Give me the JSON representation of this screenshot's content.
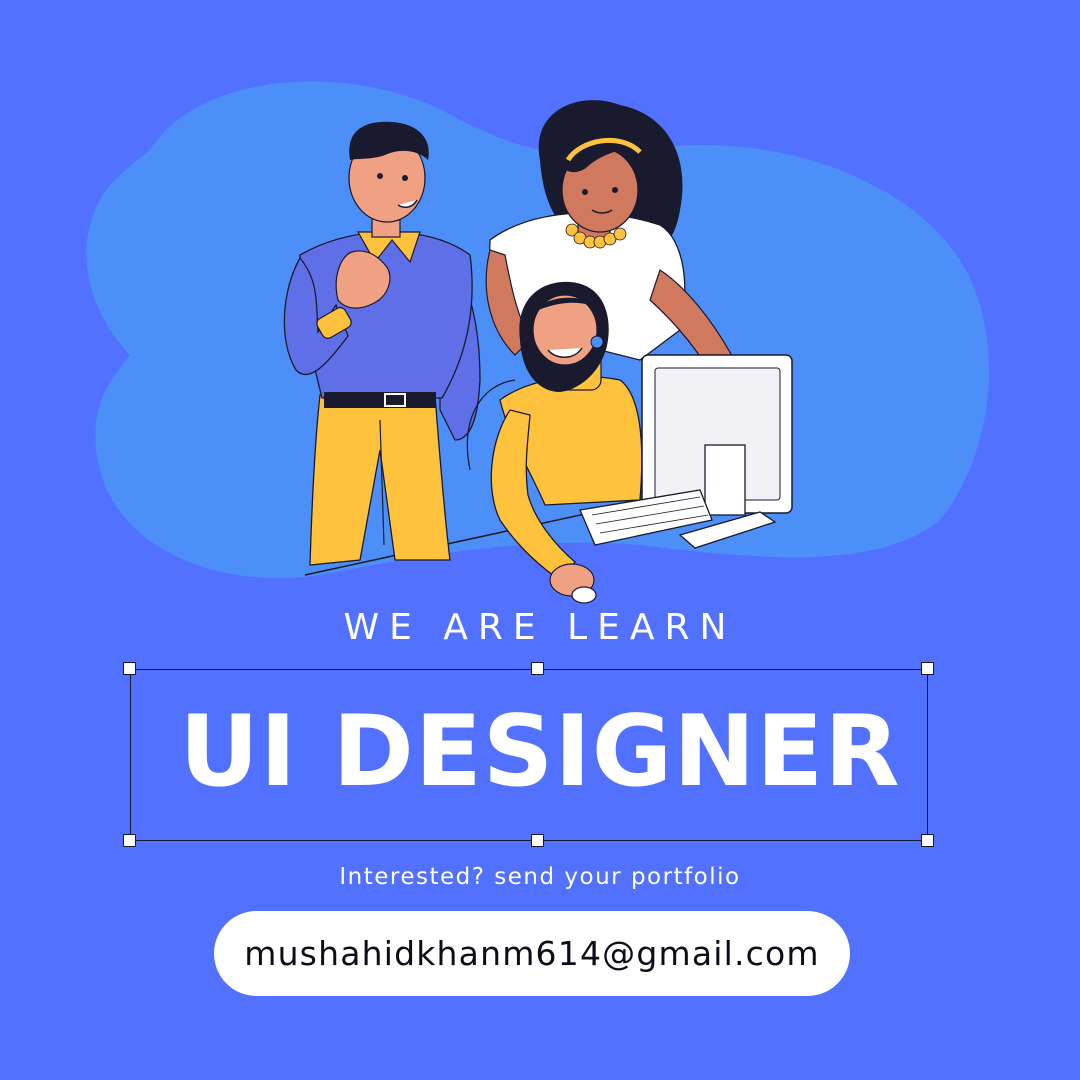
{
  "poster": {
    "tagline": "WE ARE LEARN",
    "headline": "UI DESIGNER",
    "subline": "Interested? send your portfolio",
    "email": "mushahidkhanm614@gmail.com"
  },
  "colors": {
    "background": "#5271ff",
    "blob": "#4d8ff8",
    "text": "#ffffff",
    "pill": "#ffffff",
    "pill_text": "#0d0d1a",
    "accent_yellow": "#ffc23d"
  },
  "illustration": {
    "subject": "three-people-at-computer",
    "icons": [
      "man-figure",
      "curly-hair-woman-figure",
      "seated-woman-figure",
      "computer-monitor-icon",
      "keyboard-icon",
      "mouse-icon"
    ]
  }
}
